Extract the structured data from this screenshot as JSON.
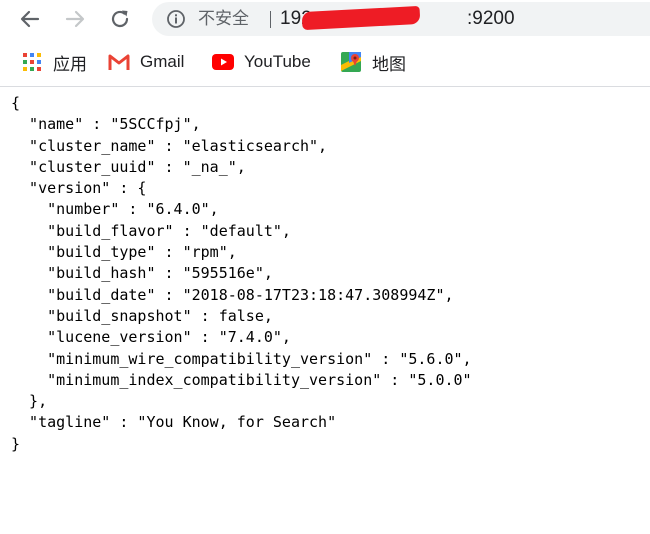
{
  "browser": {
    "security_label": "不安全",
    "url_host_prefix": "192.",
    "url_port": ":9200"
  },
  "bookmarks": [
    {
      "label": "应用",
      "icon": "apps-grid-icon"
    },
    {
      "label": "Gmail",
      "icon": "gmail-icon"
    },
    {
      "label": "YouTube",
      "icon": "youtube-icon"
    },
    {
      "label": "地图",
      "icon": "maps-icon"
    }
  ],
  "json_lines": [
    "{",
    "  \"name\" : \"5SCCfpj\",",
    "  \"cluster_name\" : \"elasticsearch\",",
    "  \"cluster_uuid\" : \"_na_\",",
    "  \"version\" : {",
    "    \"number\" : \"6.4.0\",",
    "    \"build_flavor\" : \"default\",",
    "    \"build_type\" : \"rpm\",",
    "    \"build_hash\" : \"595516e\",",
    "    \"build_date\" : \"2018-08-17T23:18:47.308994Z\",",
    "    \"build_snapshot\" : false,",
    "    \"lucene_version\" : \"7.4.0\",",
    "    \"minimum_wire_compatibility_version\" : \"5.6.0\",",
    "    \"minimum_index_compatibility_version\" : \"5.0.0\"",
    "  },",
    "  \"tagline\" : \"You Know, for Search\"",
    "}"
  ]
}
